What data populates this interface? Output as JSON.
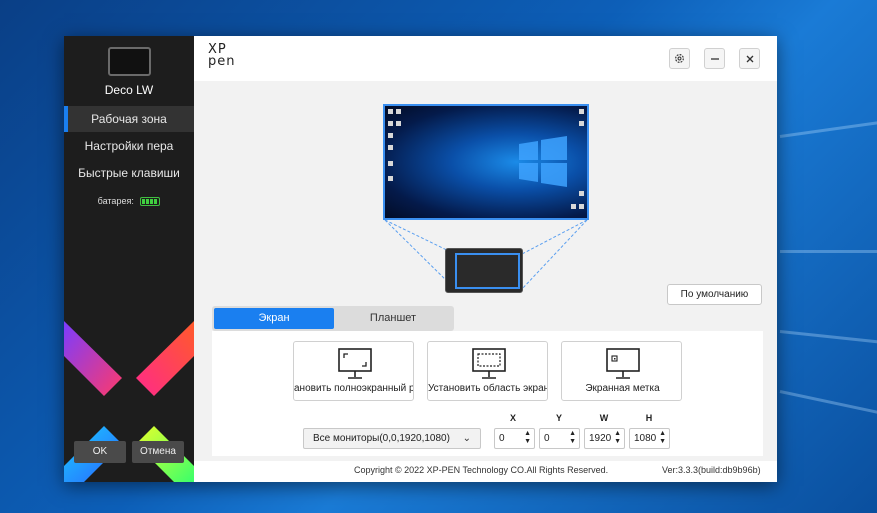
{
  "sidebar": {
    "device_name": "Deco LW",
    "nav": [
      {
        "label": "Рабочая зона"
      },
      {
        "label": "Настройки пера"
      },
      {
        "label": "Быстрые клавиши"
      }
    ],
    "battery_label": "батарея:",
    "ok_label": "OK",
    "cancel_label": "Отмена"
  },
  "header": {
    "brand_line1": "XP",
    "brand_line2": "pen"
  },
  "workspace": {
    "default_button": "По умолчанию",
    "tabs": [
      {
        "label": "Экран"
      },
      {
        "label": "Планшет"
      }
    ],
    "mode_cards": [
      {
        "label": "ановить полноэкранный реж",
        "icon": "fullscreen-monitor-icon"
      },
      {
        "label": "Установить область экрана",
        "icon": "area-monitor-icon"
      },
      {
        "label": "Экранная метка",
        "icon": "screen-mark-icon"
      }
    ],
    "monitor_select": "Все мониторы(0,0,1920,1080)",
    "coords": {
      "x_label": "X",
      "y_label": "Y",
      "w_label": "W",
      "h_label": "H",
      "x": "0",
      "y": "0",
      "w": "1920",
      "h": "1080"
    }
  },
  "footer": {
    "copyright": "Copyright © 2022  XP-PEN Technology CO.All Rights Reserved.",
    "version": "Ver:3.3.3(build:db9b96b)"
  },
  "colors": {
    "accent": "#1a7ff0",
    "sidebar_bg": "#1d1d1d",
    "battery": "#40d040"
  }
}
